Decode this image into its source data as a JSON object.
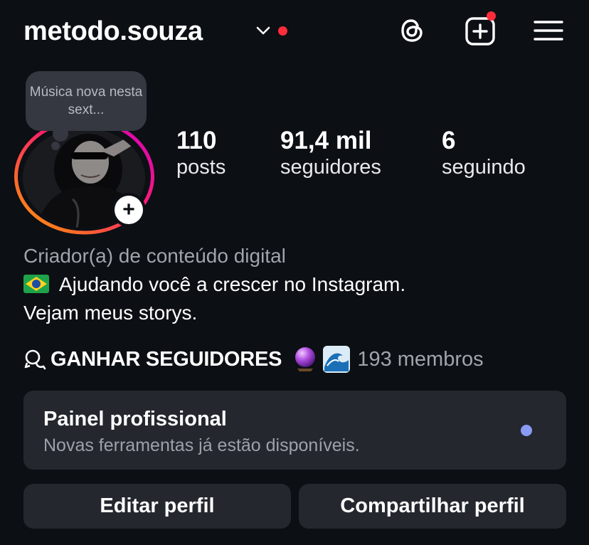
{
  "header": {
    "username": "metodo.souza",
    "icons": [
      "chevron-down-icon",
      "threads-icon",
      "create-post-icon",
      "menu-icon"
    ],
    "notification_color": "#ff2d3b"
  },
  "profile": {
    "note": "Música nova nesta sext...",
    "story_ring_colors": [
      "#ff9e00",
      "#ff1f6a",
      "#d300c5"
    ]
  },
  "stats": [
    {
      "value": "110",
      "label": "posts"
    },
    {
      "value": "91,4 mil",
      "label": "seguidores"
    },
    {
      "value": "6",
      "label": "seguindo"
    }
  ],
  "bio": {
    "category": "Criador(a) de conteúdo digital",
    "line1": "Ajudando você a crescer no Instagram.",
    "line2": "Vejam meus storys."
  },
  "channel": {
    "name": "GANHAR SEGUIDORES",
    "members": "193 membros"
  },
  "dashboard": {
    "title": "Painel profissional",
    "subtitle": "Novas ferramentas já estão disponíveis.",
    "dot_color": "#8a9bf5"
  },
  "actions": {
    "edit": "Editar perfil",
    "share": "Compartilhar perfil"
  },
  "colors": {
    "background": "#0c0f14",
    "card": "#24272e",
    "muted_text": "#a0a4ac"
  }
}
